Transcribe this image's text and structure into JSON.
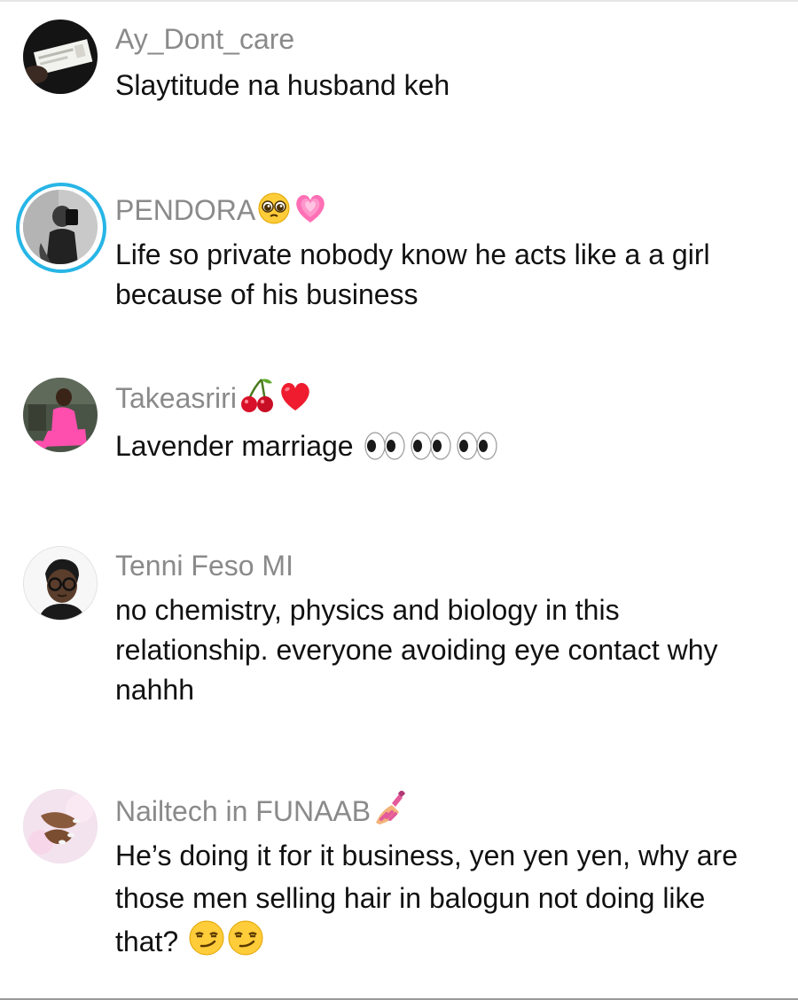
{
  "comments": [
    {
      "username": "Ay_Dont_care",
      "text": "Slaytitude na husband keh",
      "avatar_icon": "avatar-ticket-photo"
    },
    {
      "username": "PENDORA",
      "username_emojis": [
        "pleading-face-emoji",
        "growing-heart-emoji"
      ],
      "text": "Life so private nobody know he acts like a a girl because of his business",
      "has_story_ring": true,
      "story_ring_color": "#27b5e6",
      "avatar_icon": "avatar-mirror-selfie"
    },
    {
      "username": "Takeasriri",
      "username_emojis": [
        "cherries-emoji",
        "red-heart-emoji"
      ],
      "text": "Lavender marriage",
      "text_emojis": [
        "eyes-emoji",
        "eyes-emoji",
        "eyes-emoji"
      ],
      "avatar_icon": "avatar-pink-outfit"
    },
    {
      "username": "Tenni Feso MI",
      "text": "no chemistry, physics and biology in this relationship. everyone avoiding eye contact why nahhh",
      "avatar_icon": "avatar-glasses-illustration"
    },
    {
      "username": "Nailtech in FUNAAB",
      "username_emojis": [
        "nail-polish-emoji"
      ],
      "text": "He’s doing it for it business, yen yen yen, why are those men selling hair in balogun not doing like that?",
      "text_emojis": [
        "smirking-face-emoji",
        "smirking-face-emoji"
      ],
      "avatar_icon": "avatar-nails-photo"
    }
  ],
  "colors": {
    "username": "#8a8a8a",
    "text": "#111111",
    "background": "#ffffff"
  }
}
